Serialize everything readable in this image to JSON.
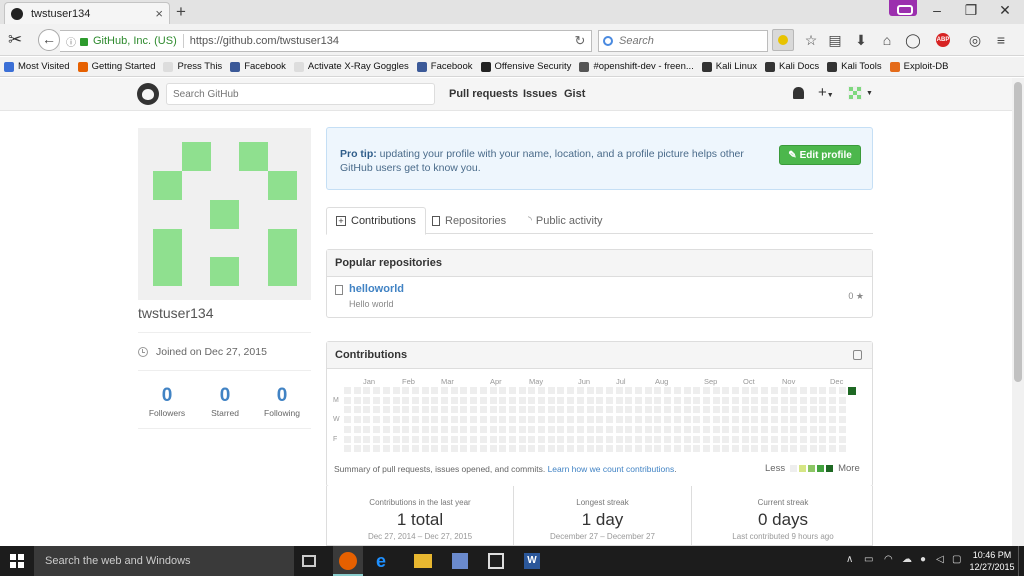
{
  "browser": {
    "tab_title": "twstuser134",
    "tab_close": "×",
    "new_tab": "+",
    "identity": "GitHub, Inc. (US)",
    "url": "https://github.com/twstuser134",
    "search_placeholder": "Search",
    "bookmarks": [
      {
        "label": "Most Visited",
        "color": "#3b6fd6"
      },
      {
        "label": "Getting Started",
        "color": "#e66000"
      },
      {
        "label": "Press This",
        "color": "#dddddd"
      },
      {
        "label": "Facebook",
        "color": "#3b5998"
      },
      {
        "label": "Activate X-Ray Goggles",
        "color": "#dddddd"
      },
      {
        "label": "Facebook",
        "color": "#3b5998"
      },
      {
        "label": "Offensive Security",
        "color": "#222222"
      },
      {
        "label": "#openshift-dev - freen...",
        "color": "#555555"
      },
      {
        "label": "Kali Linux",
        "color": "#333333"
      },
      {
        "label": "Kali Docs",
        "color": "#333333"
      },
      {
        "label": "Kali Tools",
        "color": "#333333"
      },
      {
        "label": "Exploit-DB",
        "color": "#e46b1a"
      }
    ]
  },
  "github": {
    "search_placeholder": "Search GitHub",
    "nav": [
      "Pull requests",
      "Issues",
      "Gist"
    ]
  },
  "profile": {
    "username": "twstuser134",
    "joined": "Joined on Dec 27, 2015",
    "stats": [
      {
        "value": "0",
        "label": "Followers"
      },
      {
        "value": "0",
        "label": "Starred"
      },
      {
        "value": "0",
        "label": "Following"
      }
    ]
  },
  "protip": {
    "lead": "Pro tip:",
    "text": "updating your profile with your name, location, and a profile picture helps other GitHub users get to know you.",
    "button": "Edit profile"
  },
  "tabs": [
    "Contributions",
    "Repositories",
    "Public activity"
  ],
  "popular": {
    "title": "Popular repositories",
    "repos": [
      {
        "name": "helloworld",
        "description": "Hello world",
        "stars": "0"
      }
    ]
  },
  "contributions": {
    "title": "Contributions",
    "months": [
      "Jan",
      "Feb",
      "Mar",
      "Apr",
      "May",
      "Jun",
      "Jul",
      "Aug",
      "Sep",
      "Oct",
      "Nov",
      "Dec"
    ],
    "day_labels": [
      "M",
      "W",
      "F"
    ],
    "summary": "Summary of pull requests, issues opened, and commits.",
    "learn_link": "Learn how we count contributions",
    "summary_end": ".",
    "legend_less": "Less",
    "legend_more": "More",
    "legend_colors": [
      "#eeeeee",
      "#d6e685",
      "#8cc665",
      "#44a340",
      "#1e6823"
    ],
    "weeks": 53,
    "active_cell": {
      "week": 52,
      "day": 0,
      "color": "#1e6823"
    }
  },
  "streaks": [
    {
      "label": "Contributions in the last year",
      "value": "1 total",
      "sub": "Dec 27, 2014 – Dec 27, 2015"
    },
    {
      "label": "Longest streak",
      "value": "1 day",
      "sub": "December 27 – December 27"
    },
    {
      "label": "Current streak",
      "value": "0 days",
      "sub": "Last contributed 9 hours ago"
    }
  ],
  "taskbar": {
    "search": "Search the web and Windows",
    "time": "10:46 PM",
    "date": "12/27/2015"
  },
  "colors": {
    "accent_green": "#4cb74c",
    "link_blue": "#4183c4",
    "identicon": "#8fe08f"
  }
}
